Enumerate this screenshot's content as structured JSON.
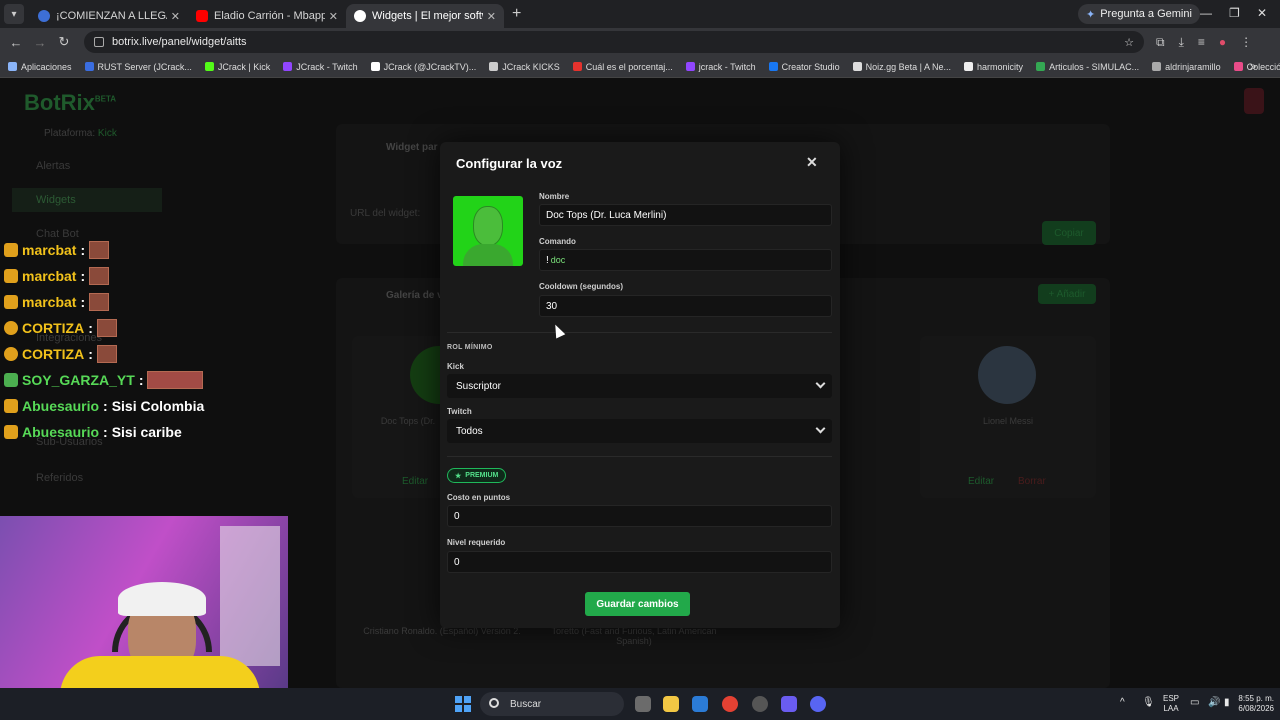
{
  "browser": {
    "tabs": [
      {
        "label": "¡COMIENZAN A LLEGAR LAS C",
        "fav_color": "#3d6fd6"
      },
      {
        "label": "Eladio Carrión - Mbappe (Vide",
        "fav_color": "#ff0000"
      },
      {
        "label": "Widgets | El mejor software pa",
        "fav_color": "#ffffff"
      }
    ],
    "gemini_label": "Pregunta a Gemini",
    "url": "botrix.live/panel/widget/aitts",
    "bookmarks": [
      {
        "label": "Aplicaciones",
        "color": "#8ab4f8"
      },
      {
        "label": "RUST Server (JCrack...",
        "color": "#3a6de0"
      },
      {
        "label": "JCrack | Kick",
        "color": "#53fc18"
      },
      {
        "label": "JCrack - Twitch",
        "color": "#9146ff"
      },
      {
        "label": "JCrack (@JCrackTV)...",
        "color": "#ffffff"
      },
      {
        "label": "JCrack KICKS",
        "color": "#cccccc"
      },
      {
        "label": "Cuál es el porcentaj...",
        "color": "#e5322d"
      },
      {
        "label": "jcrack - Twitch",
        "color": "#9146ff"
      },
      {
        "label": "Creator Studio",
        "color": "#1877f2"
      },
      {
        "label": "Noiz.gg Beta | A Ne...",
        "color": "#dddddd"
      },
      {
        "label": "harmonicity",
        "color": "#eeeeee"
      },
      {
        "label": "Articulos - SIMULAC...",
        "color": "#34a853"
      },
      {
        "label": "aldrinjaramillo",
        "color": "#aaaaaa"
      },
      {
        "label": "Colección de M_blei...",
        "color": "#e94c89"
      }
    ]
  },
  "page": {
    "logo": "BotRix",
    "logo_beta": "BETA",
    "platform_label": "Plataforma:",
    "platform_value": "Kick",
    "sidebar": [
      "Alertas",
      "Widgets",
      "Chat Bot",
      "Integraciones",
      "Sub-Usuarios",
      "Referidos"
    ],
    "widget_panel_title": "Widget par",
    "url_label": "URL del widget:",
    "copy_btn": "Copiar",
    "gallery_title": "Galería de v",
    "add_btn": "+ Añadir",
    "voice_cards": [
      {
        "name": "Doc Tops (Dr."
      },
      {
        "name": "Lionel Messi"
      },
      {
        "name": "Cristiano Ronaldo. (Español) Versión 2."
      },
      {
        "name": "Toretto (Fast and Furious, Latin American Spanish)"
      }
    ],
    "edit_label": "Editar",
    "delete_label": "Borrar"
  },
  "chat": [
    {
      "user": "marcbat",
      "message": "",
      "color": "yellow",
      "badge": "crown",
      "emote": "small"
    },
    {
      "user": "marcbat",
      "message": "",
      "color": "yellow",
      "badge": "crown",
      "emote": "small"
    },
    {
      "user": "marcbat",
      "message": "",
      "color": "yellow",
      "badge": "crown",
      "emote": "small"
    },
    {
      "user": "CORTIZA",
      "message": "",
      "color": "yellow",
      "badge": "round",
      "emote": "small"
    },
    {
      "user": "CORTIZA",
      "message": "",
      "color": "yellow",
      "badge": "round",
      "emote": "small"
    },
    {
      "user": "SOY_GARZA_YT",
      "message": "",
      "color": "green",
      "badge": "green",
      "emote": "wide"
    },
    {
      "user": "Abuesaurio",
      "message": "Sisi Colombia",
      "color": "green",
      "badge": "crown",
      "emote": ""
    },
    {
      "user": "Abuesaurio",
      "message": "Sisi caribe",
      "color": "green",
      "badge": "crown",
      "emote": ""
    }
  ],
  "modal": {
    "title": "Configurar la voz",
    "name_label": "Nombre",
    "name_value": "Doc Tops (Dr. Luca Merlini)",
    "command_label": "Comando",
    "command_prefix": "!",
    "command_value": "doc",
    "cooldown_label": "Cooldown (segundos)",
    "cooldown_value": "30",
    "min_role_label": "ROL MÍNIMO",
    "kick_label": "Kick",
    "kick_value": "Suscriptor",
    "twitch_label": "Twitch",
    "twitch_value": "Todos",
    "premium_badge": "PREMIUM",
    "points_label": "Costo en puntos",
    "points_value": "0",
    "level_label": "Nivel requerido",
    "level_value": "0",
    "save_label": "Guardar cambios"
  },
  "taskbar": {
    "search_label": "Buscar",
    "lang_top": "ESP",
    "lang_bottom": "LAA",
    "time": "8:55 p. m.",
    "date": "6/08/2026"
  }
}
